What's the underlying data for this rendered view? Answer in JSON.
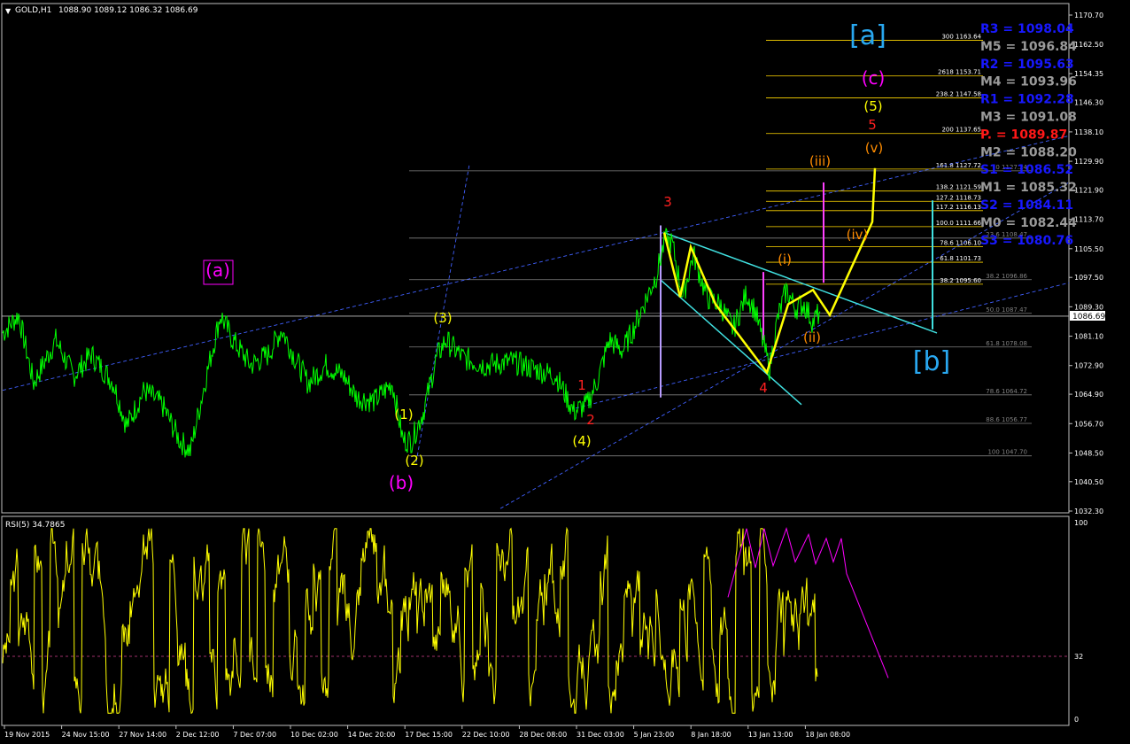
{
  "colors": {
    "background": "#000000",
    "grid": "#c0c0c0",
    "price": "#00ff00",
    "rsi": "#ffff00",
    "fib": "#808080",
    "fib_upper": "#ffd700",
    "trendline": "#4060ff",
    "wedge": "#40e0e0",
    "projection": "#ffff00",
    "magenta": "#ff00ff",
    "orange": "#ff8c00",
    "cyan_label": "#29a8f0",
    "red_label": "#ff2020",
    "pivot_blue": "#1818ff",
    "pivot_gray": "#9a9a9a",
    "pivot_red": "#ff1818"
  },
  "header": {
    "symbol": "GOLD,H1",
    "ohlc": "1088.90 1089.12 1086.32 1086.69",
    "rsi_label": "RSI(5) 34.7865"
  },
  "current_price": "1086.69",
  "chart_data": {
    "type": "line",
    "title": "GOLD,H1",
    "price_axis": {
      "range": [
        1032.3,
        1170.7
      ],
      "ticks": [
        "1170.70",
        "1162.50",
        "1154.35",
        "1146.30",
        "1138.10",
        "1129.90",
        "1121.90",
        "1113.70",
        "1105.50",
        "1097.50",
        "1089.30",
        "1081.10",
        "1072.90",
        "1064.90",
        "1056.70",
        "1048.50",
        "1040.50",
        "1032.30"
      ]
    },
    "rsi_axis": {
      "range": [
        0,
        100
      ],
      "ticks": [
        "100",
        "32",
        "0"
      ],
      "level": 32
    },
    "time_axis": [
      "19 Nov 2015",
      "24 Nov 15:00",
      "27 Nov 14:00",
      "2 Dec 12:00",
      "7 Dec 07:00",
      "10 Dec 02:00",
      "14 Dec 20:00",
      "17 Dec 15:00",
      "22 Dec 10:00",
      "28 Dec 08:00",
      "31 Dec 03:00",
      "5 Jan 23:00",
      "8 Jan 18:00",
      "13 Jan 13:00",
      "18 Jan 08:00"
    ],
    "price_key_points": [
      {
        "i": 0,
        "v": 1082
      },
      {
        "i": 18,
        "v": 1087
      },
      {
        "i": 35,
        "v": 1068
      },
      {
        "i": 60,
        "v": 1080
      },
      {
        "i": 80,
        "v": 1070
      },
      {
        "i": 100,
        "v": 1076
      },
      {
        "i": 125,
        "v": 1068
      },
      {
        "i": 140,
        "v": 1056
      },
      {
        "i": 160,
        "v": 1066
      },
      {
        "i": 180,
        "v": 1062
      },
      {
        "i": 200,
        "v": 1052
      },
      {
        "i": 212,
        "v": 1049
      },
      {
        "i": 230,
        "v": 1070
      },
      {
        "i": 246,
        "v": 1087
      },
      {
        "i": 260,
        "v": 1080
      },
      {
        "i": 280,
        "v": 1073
      },
      {
        "i": 300,
        "v": 1076
      },
      {
        "i": 315,
        "v": 1083
      },
      {
        "i": 330,
        "v": 1075
      },
      {
        "i": 345,
        "v": 1068
      },
      {
        "i": 365,
        "v": 1073
      },
      {
        "i": 385,
        "v": 1070
      },
      {
        "i": 400,
        "v": 1064
      },
      {
        "i": 420,
        "v": 1063
      },
      {
        "i": 440,
        "v": 1068
      },
      {
        "i": 452,
        "v": 1052
      },
      {
        "i": 462,
        "v": 1052
      },
      {
        "i": 475,
        "v": 1060
      },
      {
        "i": 490,
        "v": 1075
      },
      {
        "i": 500,
        "v": 1080
      },
      {
        "i": 520,
        "v": 1075
      },
      {
        "i": 545,
        "v": 1073
      },
      {
        "i": 575,
        "v": 1074
      },
      {
        "i": 600,
        "v": 1072
      },
      {
        "i": 625,
        "v": 1070
      },
      {
        "i": 645,
        "v": 1060
      },
      {
        "i": 660,
        "v": 1062
      },
      {
        "i": 672,
        "v": 1069
      },
      {
        "i": 685,
        "v": 1080
      },
      {
        "i": 700,
        "v": 1077
      },
      {
        "i": 712,
        "v": 1083
      },
      {
        "i": 724,
        "v": 1090
      },
      {
        "i": 738,
        "v": 1098
      },
      {
        "i": 748,
        "v": 1108
      },
      {
        "i": 756,
        "v": 1107
      },
      {
        "i": 768,
        "v": 1092
      },
      {
        "i": 780,
        "v": 1104
      },
      {
        "i": 795,
        "v": 1092
      },
      {
        "i": 810,
        "v": 1090
      },
      {
        "i": 825,
        "v": 1083
      },
      {
        "i": 840,
        "v": 1093
      },
      {
        "i": 850,
        "v": 1088
      },
      {
        "i": 858,
        "v": 1080
      },
      {
        "i": 866,
        "v": 1072
      },
      {
        "i": 875,
        "v": 1086
      },
      {
        "i": 885,
        "v": 1094
      },
      {
        "i": 895,
        "v": 1089
      },
      {
        "i": 905,
        "v": 1090
      },
      {
        "i": 915,
        "v": 1085
      },
      {
        "i": 923,
        "v": 1088
      }
    ],
    "fib_levels_lower": [
      {
        "label": "100 1047.70",
        "v": 1047.7
      },
      {
        "label": "88.6 1056.77",
        "v": 1056.77
      },
      {
        "label": "78.6 1064.72",
        "v": 1064.72
      },
      {
        "label": "61.8 1078.08",
        "v": 1078.08
      },
      {
        "label": "50.0 1087.47",
        "v": 1087.47
      },
      {
        "label": "38.2 1096.86",
        "v": 1096.86
      },
      {
        "label": "23.6 1108.47",
        "v": 1108.47
      },
      {
        "label": "0 1127.24",
        "v": 1127.24
      }
    ],
    "fib_levels_upper": [
      {
        "label": "300 1163.64",
        "v": 1163.64
      },
      {
        "label": "2618 1153.71",
        "v": 1153.71
      },
      {
        "label": "238.2 1147.58",
        "v": 1147.58
      },
      {
        "label": "200 1137.65",
        "v": 1137.65
      },
      {
        "label": "161.8 1127.72",
        "v": 1127.72
      },
      {
        "label": "138.2 1121.59",
        "v": 1121.59
      },
      {
        "label": "127.2 1118.73",
        "v": 1118.73
      },
      {
        "label": "117.2 1116.13",
        "v": 1116.13
      },
      {
        "label": "100.0 1111.66",
        "v": 1111.66
      },
      {
        "label": "78.6 1106.10",
        "v": 1106.1
      },
      {
        "label": "61.8 1101.73",
        "v": 1101.73
      },
      {
        "label": "38.2 1095.60",
        "v": 1095.6
      }
    ],
    "pivots": [
      {
        "label": "R3 = 1098.04",
        "kind": "blue"
      },
      {
        "label": "M5 = 1096.84",
        "kind": "gray"
      },
      {
        "label": "R2 = 1095.63",
        "kind": "blue"
      },
      {
        "label": "M4 = 1093.96",
        "kind": "gray"
      },
      {
        "label": "R1 = 1092.28",
        "kind": "blue"
      },
      {
        "label": "M3 = 1091.08",
        "kind": "gray"
      },
      {
        "label": "P. = 1089.87",
        "kind": "red"
      },
      {
        "label": "M2 = 1088.20",
        "kind": "gray"
      },
      {
        "label": "S1 = 1086.52",
        "kind": "blue"
      },
      {
        "label": "M1 = 1085.32",
        "kind": "gray"
      },
      {
        "label": "S2 = 1084.11",
        "kind": "blue"
      },
      {
        "label": "M0 = 1082.44",
        "kind": "gray"
      },
      {
        "label": "S3 = 1080.76",
        "kind": "blue"
      }
    ],
    "wave_labels": [
      {
        "text": "[a]",
        "color": "cyan_label",
        "size": "xl"
      },
      {
        "text": "[b]",
        "color": "cyan_label",
        "size": "xl"
      },
      {
        "text": "(a)",
        "color": "magenta",
        "size": "lg"
      },
      {
        "text": "(b)",
        "color": "magenta",
        "size": "lg"
      },
      {
        "text": "(c)",
        "color": "magenta",
        "size": "lg"
      },
      {
        "text": "(1)",
        "color": "projection",
        "size": "md"
      },
      {
        "text": "(2)",
        "color": "projection",
        "size": "md"
      },
      {
        "text": "(3)",
        "color": "projection",
        "size": "md"
      },
      {
        "text": "(4)",
        "color": "projection",
        "size": "md"
      },
      {
        "text": "(5)",
        "color": "projection",
        "size": "md"
      },
      {
        "text": "1",
        "color": "red_label",
        "size": "md"
      },
      {
        "text": "2",
        "color": "red_label",
        "size": "md"
      },
      {
        "text": "3",
        "color": "red_label",
        "size": "md"
      },
      {
        "text": "4",
        "color": "red_label",
        "size": "md"
      },
      {
        "text": "5",
        "color": "red_label",
        "size": "md"
      },
      {
        "text": "(i)",
        "color": "orange",
        "size": "md"
      },
      {
        "text": "(ii)",
        "color": "orange",
        "size": "md"
      },
      {
        "text": "(iii)",
        "color": "orange",
        "size": "md"
      },
      {
        "text": "(iv)",
        "color": "orange",
        "size": "md"
      },
      {
        "text": "(v)",
        "color": "orange",
        "size": "md"
      }
    ]
  }
}
